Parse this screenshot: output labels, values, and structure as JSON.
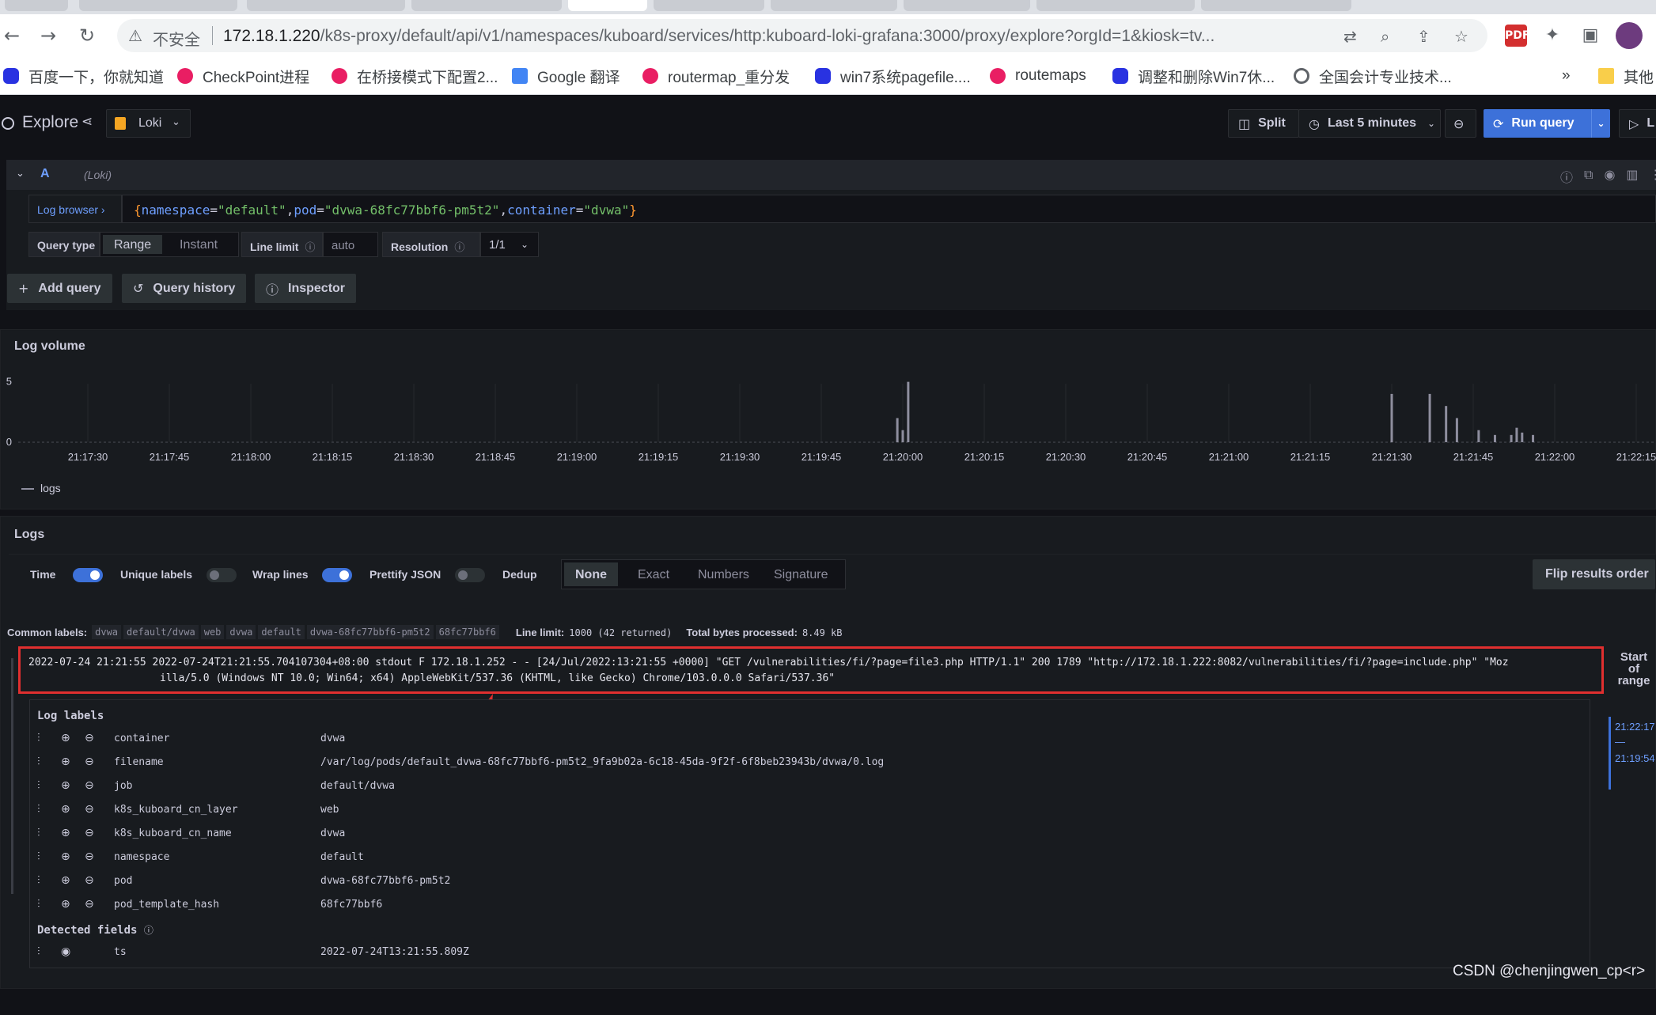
{
  "browser": {
    "insecure_label": "不安全",
    "url_host": "172.18.1.220",
    "url_path": "/k8s-proxy/default/api/v1/namespaces/kuboard/services/http:kuboard-loki-grafana:3000/proxy/explore?orgId=1&kiosk=tv...",
    "bookmarks": [
      {
        "label": "百度一下，你就知道",
        "icon": "baidu-paw-icon"
      },
      {
        "label": "CheckPoint进程",
        "icon": "pink-favicon"
      },
      {
        "label": "在桥接模式下配置2...",
        "icon": "pink-favicon"
      },
      {
        "label": "Google 翻译",
        "icon": "google-translate-icon"
      },
      {
        "label": "routermap_重分发",
        "icon": "pink-favicon"
      },
      {
        "label": "win7系统pagefile....",
        "icon": "baidu-paw-icon"
      },
      {
        "label": "routemaps",
        "icon": "pink-favicon"
      },
      {
        "label": "调整和删除Win7休...",
        "icon": "baidu-paw-icon"
      },
      {
        "label": "全国会计专业技术...",
        "icon": "globe-icon"
      }
    ],
    "bookmarks_more": "»",
    "other_bookmarks": "其他"
  },
  "topbar": {
    "title": "Explore",
    "datasource": "Loki",
    "split_label": "Split",
    "time_range": "Last 5 minutes",
    "run_query": "Run query",
    "live_label": "L"
  },
  "query": {
    "ref_id": "A",
    "datasource_hint": "(Loki)",
    "log_browser": "Log browser ›",
    "expr": {
      "namespace_key": "namespace",
      "namespace_val": "\"default\"",
      "pod_key": "pod",
      "pod_val": "\"dvwa-68fc77bbf6-pm5t2\"",
      "container_key": "container",
      "container_val": "\"dvwa\""
    },
    "query_type_label": "Query type",
    "range_label": "Range",
    "instant_label": "Instant",
    "line_limit_label": "Line limit",
    "line_limit_placeholder": "auto",
    "resolution_label": "Resolution",
    "resolution_value": "1/1"
  },
  "actions": {
    "add_query": "Add query",
    "query_history": "Query history",
    "inspector": "Inspector"
  },
  "log_volume": {
    "title": "Log volume",
    "legend": "logs"
  },
  "chart_data": {
    "type": "bar",
    "title": "Log volume",
    "series": [
      {
        "name": "logs",
        "color": "#8e8e9e"
      }
    ],
    "y_ticks": [
      "0",
      "5"
    ],
    "ylim": [
      0,
      5.5
    ],
    "x_ticks": [
      "21:17:30",
      "21:17:45",
      "21:18:00",
      "21:18:15",
      "21:18:30",
      "21:18:45",
      "21:19:00",
      "21:19:15",
      "21:19:30",
      "21:19:45",
      "21:20:00",
      "21:20:15",
      "21:20:30",
      "21:20:45",
      "21:21:00",
      "21:21:15",
      "21:21:30",
      "21:21:45",
      "21:22:00",
      "21:22:15"
    ],
    "points": [
      {
        "t": "21:19:59",
        "v": 2
      },
      {
        "t": "21:20:00",
        "v": 1
      },
      {
        "t": "21:20:01",
        "v": 5
      },
      {
        "t": "21:21:30",
        "v": 4
      },
      {
        "t": "21:21:37",
        "v": 4
      },
      {
        "t": "21:21:40",
        "v": 3
      },
      {
        "t": "21:21:42",
        "v": 2
      },
      {
        "t": "21:21:46",
        "v": 1
      },
      {
        "t": "21:21:49",
        "v": 0.6
      },
      {
        "t": "21:21:52",
        "v": 0.6
      },
      {
        "t": "21:21:53",
        "v": 1.2
      },
      {
        "t": "21:21:54",
        "v": 0.8
      },
      {
        "t": "21:21:56",
        "v": 0.6
      }
    ],
    "grid": true,
    "legend": "bottom-left"
  },
  "logs": {
    "title": "Logs",
    "time_label": "Time",
    "unique_labels": "Unique labels",
    "wrap_lines": "Wrap lines",
    "prettify_json": "Prettify JSON",
    "dedup_label": "Dedup",
    "dedup_options": [
      "None",
      "Exact",
      "Numbers",
      "Signature"
    ],
    "flip": "Flip results order",
    "common_labels_label": "Common labels:",
    "common_labels": [
      "dvwa",
      "default/dvwa",
      "web",
      "dvwa",
      "default",
      "dvwa-68fc77bbf6-pm5t2",
      "68fc77bbf6"
    ],
    "line_limit_text": "Line limit:",
    "line_limit_value": "1000 (42 returned)",
    "bytes_text": "Total bytes processed:",
    "bytes_value": "8.49 kB",
    "line_1": "2022-07-24 21:21:55 2022-07-24T21:21:55.704107304+08:00 stdout F 172.18.1.252 - - [24/Jul/2022:13:21:55 +0000] \"GET /vulnerabilities/fi/?page=file3.php HTTP/1.1\" 200 1789 \"http://172.18.1.222:8082/vulnerabilities/fi/?page=include.php\" \"Moz",
    "line_2": "illa/5.0 (Windows NT 10.0; Win64; x64) AppleWebKit/537.36 (KHTML, like Gecko) Chrome/103.0.0.0 Safari/537.36\"",
    "log_labels_title": "Log labels",
    "labels": [
      {
        "key": "container",
        "value": "dvwa"
      },
      {
        "key": "filename",
        "value": "/var/log/pods/default_dvwa-68fc77bbf6-pm5t2_9fa9b02a-6c18-45da-9f2f-6f8beb23943b/dvwa/0.log"
      },
      {
        "key": "job",
        "value": "default/dvwa"
      },
      {
        "key": "k8s_kuboard_cn_layer",
        "value": "web"
      },
      {
        "key": "k8s_kuboard_cn_name",
        "value": "dvwa"
      },
      {
        "key": "namespace",
        "value": "default"
      },
      {
        "key": "pod",
        "value": "dvwa-68fc77bbf6-pm5t2"
      },
      {
        "key": "pod_template_hash",
        "value": "68fc77bbf6"
      }
    ],
    "detected_fields_title": "Detected fields",
    "fields": [
      {
        "key": "ts",
        "value": "2022-07-24T13:21:55.809Z"
      }
    ],
    "start_of_range": "Start of range",
    "range_top": "21:22:17",
    "range_dash": "—",
    "range_bottom": "21:19:54"
  },
  "watermark": "CSDN @chenjingwen_cp<r>"
}
